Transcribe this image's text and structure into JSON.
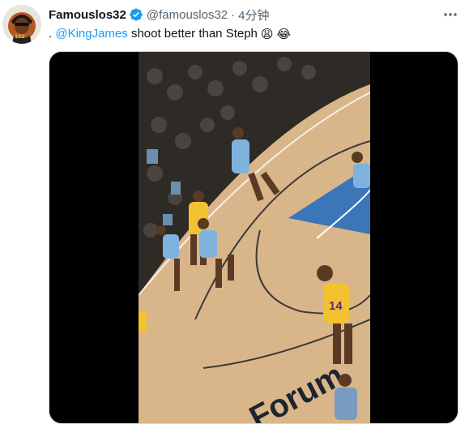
{
  "tweet": {
    "display_name": "Famouslos32",
    "handle": "@famouslos32",
    "separator": "·",
    "time": "4分钟",
    "text_prefix": ". ",
    "mention": "@KingJames",
    "text_body": " shoot better than Steph",
    "emojis": [
      "😩",
      "😂"
    ],
    "verified": true
  },
  "media": {
    "type": "video",
    "jersey_number": "14",
    "court_text": "Forum"
  },
  "icons": {
    "verified": "verified-badge-icon",
    "more": "more-dots-icon"
  },
  "colors": {
    "accent": "#1d9bf0",
    "secondary_text": "#536471",
    "primary_text": "#0f1419"
  }
}
